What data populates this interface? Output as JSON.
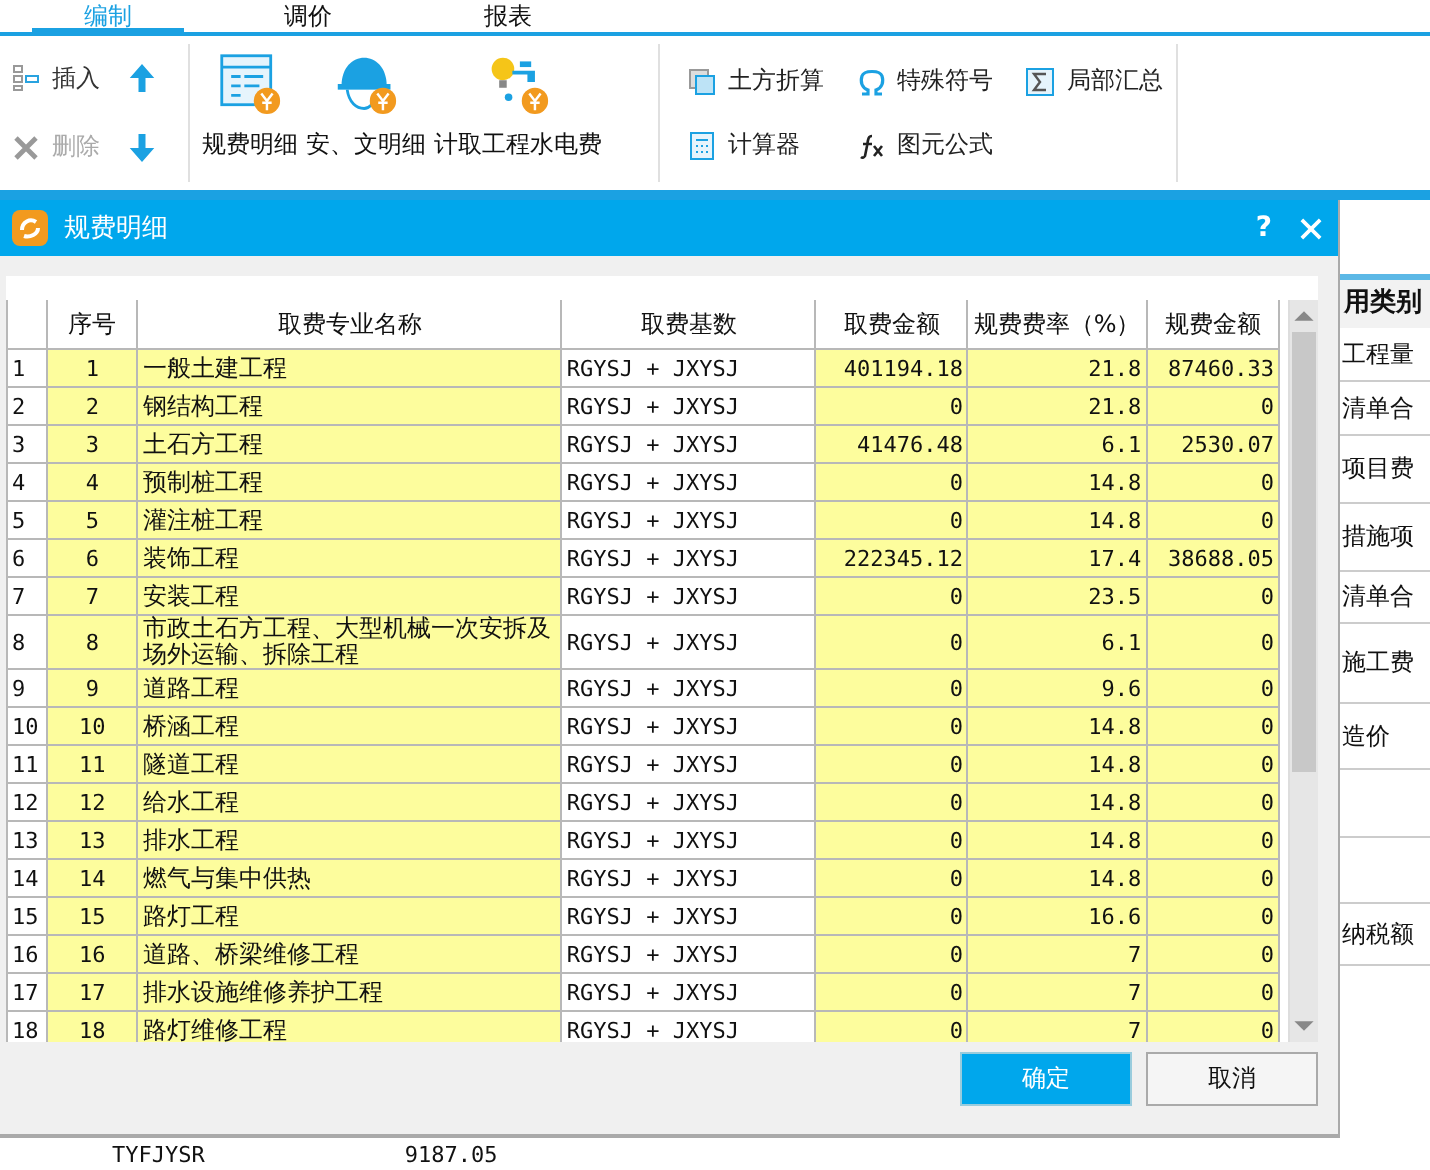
{
  "tabs": [
    {
      "label": "编制",
      "selected": true
    },
    {
      "label": "调价",
      "selected": false
    },
    {
      "label": "报表",
      "selected": false
    }
  ],
  "toolbar": {
    "edit_buttons": [
      {
        "label": "插入",
        "disabled": false,
        "kind": "insert"
      },
      {
        "label": "删除",
        "disabled": true,
        "kind": "delete"
      }
    ],
    "large_buttons": [
      {
        "label": "规费明细",
        "kind": "list"
      },
      {
        "label": "安、文明细",
        "kind": "helmet"
      },
      {
        "label": "计取工程水电费",
        "kind": "utility"
      }
    ],
    "tool_buttons": [
      {
        "label": "土方折算",
        "kind": "earth"
      },
      {
        "label": "特殊符号",
        "kind": "omega"
      },
      {
        "label": "局部汇总",
        "kind": "sigma"
      },
      {
        "label": "计算器",
        "kind": "calc"
      },
      {
        "label": "图元公式",
        "kind": "fx"
      }
    ]
  },
  "dialog": {
    "title": "规费明细",
    "help": "?",
    "columns": [
      "序号",
      "取费专业名称",
      "取费基数",
      "取费金额",
      "规费费率（%）",
      "规费金额"
    ],
    "rows": [
      {
        "row": "1",
        "no": "1",
        "name": "一般土建工程",
        "base": "RGYSJ + JXYSJ",
        "amount": "401194.18",
        "rate": "21.8",
        "fee": "87460.33"
      },
      {
        "row": "2",
        "no": "2",
        "name": "钢结构工程",
        "base": "RGYSJ + JXYSJ",
        "amount": "0",
        "rate": "21.8",
        "fee": "0"
      },
      {
        "row": "3",
        "no": "3",
        "name": "土石方工程",
        "base": "RGYSJ + JXYSJ",
        "amount": "41476.48",
        "rate": "6.1",
        "fee": "2530.07"
      },
      {
        "row": "4",
        "no": "4",
        "name": "预制桩工程",
        "base": "RGYSJ + JXYSJ",
        "amount": "0",
        "rate": "14.8",
        "fee": "0"
      },
      {
        "row": "5",
        "no": "5",
        "name": "灌注桩工程",
        "base": "RGYSJ + JXYSJ",
        "amount": "0",
        "rate": "14.8",
        "fee": "0"
      },
      {
        "row": "6",
        "no": "6",
        "name": "装饰工程",
        "base": "RGYSJ + JXYSJ",
        "amount": "222345.12",
        "rate": "17.4",
        "fee": "38688.05"
      },
      {
        "row": "7",
        "no": "7",
        "name": "安装工程",
        "base": "RGYSJ + JXYSJ",
        "amount": "0",
        "rate": "23.5",
        "fee": "0"
      },
      {
        "row": "8",
        "no": "8",
        "name": "市政土石方工程、大型机械一次安拆及场外运输、拆除工程",
        "base": "RGYSJ + JXYSJ",
        "amount": "0",
        "rate": "6.1",
        "fee": "0"
      },
      {
        "row": "9",
        "no": "9",
        "name": "道路工程",
        "base": "RGYSJ + JXYSJ",
        "amount": "0",
        "rate": "9.6",
        "fee": "0"
      },
      {
        "row": "10",
        "no": "10",
        "name": "桥涵工程",
        "base": "RGYSJ + JXYSJ",
        "amount": "0",
        "rate": "14.8",
        "fee": "0"
      },
      {
        "row": "11",
        "no": "11",
        "name": "隧道工程",
        "base": "RGYSJ + JXYSJ",
        "amount": "0",
        "rate": "14.8",
        "fee": "0"
      },
      {
        "row": "12",
        "no": "12",
        "name": "给水工程",
        "base": "RGYSJ + JXYSJ",
        "amount": "0",
        "rate": "14.8",
        "fee": "0"
      },
      {
        "row": "13",
        "no": "13",
        "name": "排水工程",
        "base": "RGYSJ + JXYSJ",
        "amount": "0",
        "rate": "14.8",
        "fee": "0"
      },
      {
        "row": "14",
        "no": "14",
        "name": "燃气与集中供热",
        "base": "RGYSJ + JXYSJ",
        "amount": "0",
        "rate": "14.8",
        "fee": "0"
      },
      {
        "row": "15",
        "no": "15",
        "name": "路灯工程",
        "base": "RGYSJ + JXYSJ",
        "amount": "0",
        "rate": "16.6",
        "fee": "0"
      },
      {
        "row": "16",
        "no": "16",
        "name": "道路、桥梁维修工程",
        "base": "RGYSJ + JXYSJ",
        "amount": "0",
        "rate": "7",
        "fee": "0"
      },
      {
        "row": "17",
        "no": "17",
        "name": "排水设施维修养护工程",
        "base": "RGYSJ + JXYSJ",
        "amount": "0",
        "rate": "7",
        "fee": "0"
      },
      {
        "row": "18",
        "no": "18",
        "name": "路灯维修工程",
        "base": "RGYSJ + JXYSJ",
        "amount": "0",
        "rate": "7",
        "fee": "0"
      }
    ],
    "ok": "确定",
    "cancel": "取消"
  },
  "background": {
    "header": "用类别",
    "cells": [
      "工程量",
      "清单合",
      "项目费",
      "措施项",
      "清单合",
      "施工费",
      "造价",
      "",
      "",
      "纳税额"
    ],
    "bottom_row": [
      "TYFJYSR",
      "9187.05"
    ]
  }
}
